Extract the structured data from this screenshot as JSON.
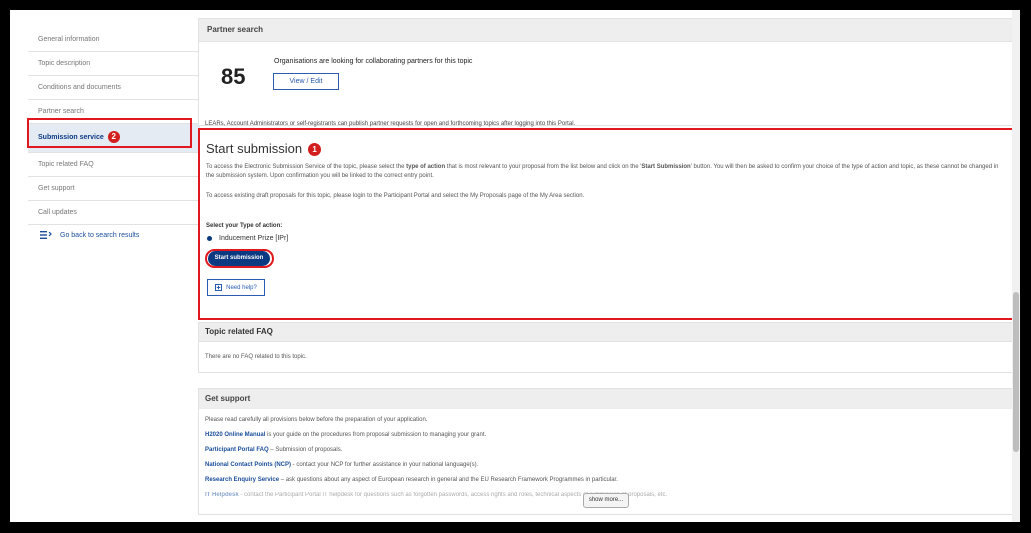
{
  "sidebar": {
    "items": [
      {
        "label": "General information"
      },
      {
        "label": "Topic description"
      },
      {
        "label": "Conditions and documents"
      },
      {
        "label": "Partner search"
      },
      {
        "label": "Submission service",
        "badge": "2"
      },
      {
        "label": "Topic related FAQ"
      },
      {
        "label": "Get support"
      },
      {
        "label": "Call updates"
      }
    ],
    "back_link": "Go back to search results"
  },
  "partner_search": {
    "title": "Partner search",
    "count": "85",
    "text": "Organisations are looking for collaborating partners for this topic",
    "button": "View / Edit",
    "note": "LEARs, Account Administrators or self-registrants can publish partner requests for open and forthcoming topics after logging into this Portal."
  },
  "submission": {
    "title": "Start submission",
    "badge": "1",
    "p1_a": "To access the Electronic Submission Service of the topic, please select the ",
    "p1_b": "type of action",
    "p1_c": " that is most relevant to your proposal from the list below and click on the '",
    "p1_d": "Start Submission",
    "p1_e": "' button. You will then be asked to confirm your choice of the type of action and topic, as these cannot be changed in the submission system. Upon confirmation you will be linked to the correct entry point.",
    "p2": "To access existing draft proposals for this topic, please login to the Participant Portal and select the My Proposals page of the My Area section.",
    "select_label": "Select your Type of action:",
    "option": "Inducement Prize [IPr]",
    "start_button": "Start submission",
    "help_button": "Need help?"
  },
  "faq": {
    "title": "Topic related FAQ",
    "body": "There are no FAQ related to this topic."
  },
  "get_support": {
    "title": "Get support",
    "intro": "Please read carefully all provisions below before the preparation of your application.",
    "l1_b": "H2020 Online Manual",
    "l1_t": " is your guide on the procedures from proposal submission to managing your grant.",
    "l2_b": "Participant Portal FAQ",
    "l2_t": " – Submission of proposals.",
    "l3_b": "National Contact Points (NCP)",
    "l3_t": " - contact your NCP for further assistance in your national language(s).",
    "l4_b": "Research Enquiry Service",
    "l4_t": " – ask questions about any aspect of European research in general and the EU Research Framework Programmes in particular.",
    "l5_b": "IT Helpdesk",
    "l5_t": " - contact the Participant Portal IT helpdesk for questions such as forgotten passwords, access rights and roles, technical aspects of submission of proposals, etc.",
    "show_more": "show more..."
  }
}
